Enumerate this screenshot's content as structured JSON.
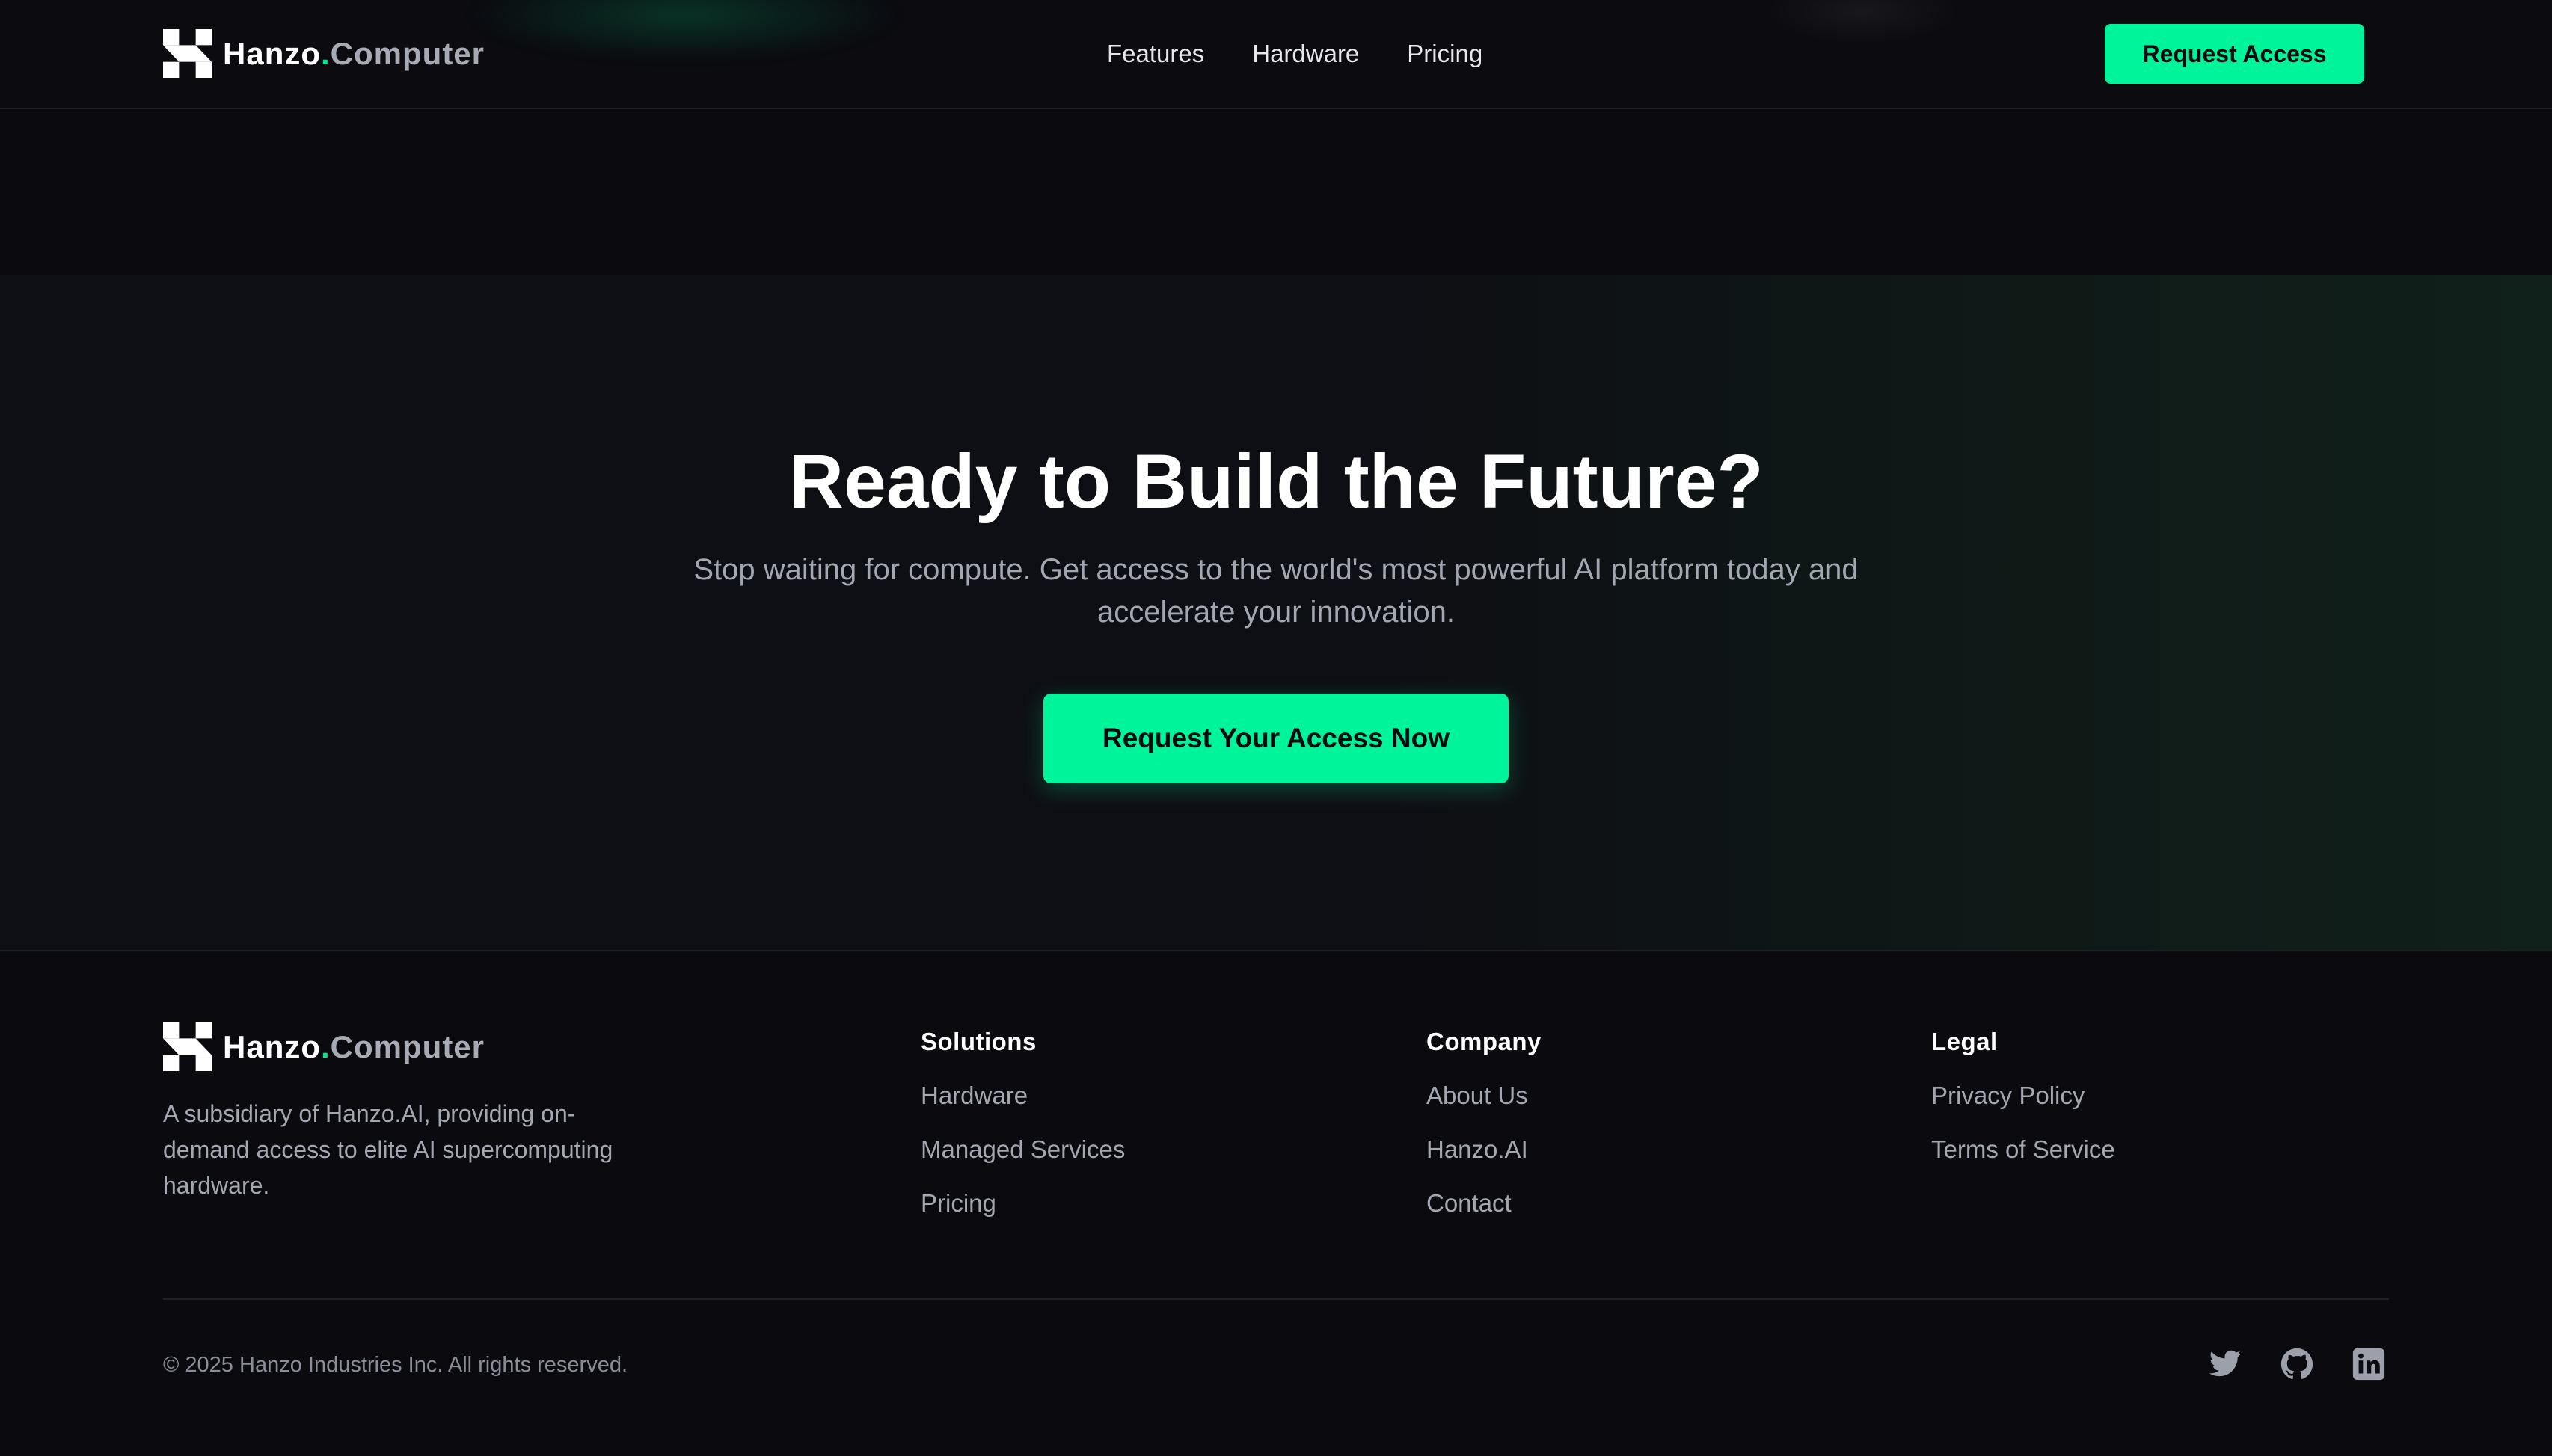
{
  "brand": {
    "name_part1": "Hanzo",
    "dot": ".",
    "name_part2": "Computer",
    "accent_color": "#00f59a"
  },
  "header": {
    "nav": [
      "Features",
      "Hardware",
      "Pricing"
    ],
    "cta_label": "Request Access"
  },
  "cta": {
    "title": "Ready to Build the Future?",
    "subtitle": "Stop waiting for compute. Get access to the world's most powerful AI platform today and accelerate your innovation.",
    "button_label": "Request Your Access Now"
  },
  "footer": {
    "description": "A subsidiary of Hanzo.AI, providing on-demand access to elite AI supercomputing hardware.",
    "columns": [
      {
        "title": "Solutions",
        "links": [
          "Hardware",
          "Managed Services",
          "Pricing"
        ]
      },
      {
        "title": "Company",
        "links": [
          "About Us",
          "Hanzo.AI",
          "Contact"
        ]
      },
      {
        "title": "Legal",
        "links": [
          "Privacy Policy",
          "Terms of Service"
        ]
      }
    ],
    "copyright": "© 2025 Hanzo Industries Inc. All rights reserved.",
    "social_icons": [
      "twitter-icon",
      "github-icon",
      "linkedin-icon"
    ]
  }
}
